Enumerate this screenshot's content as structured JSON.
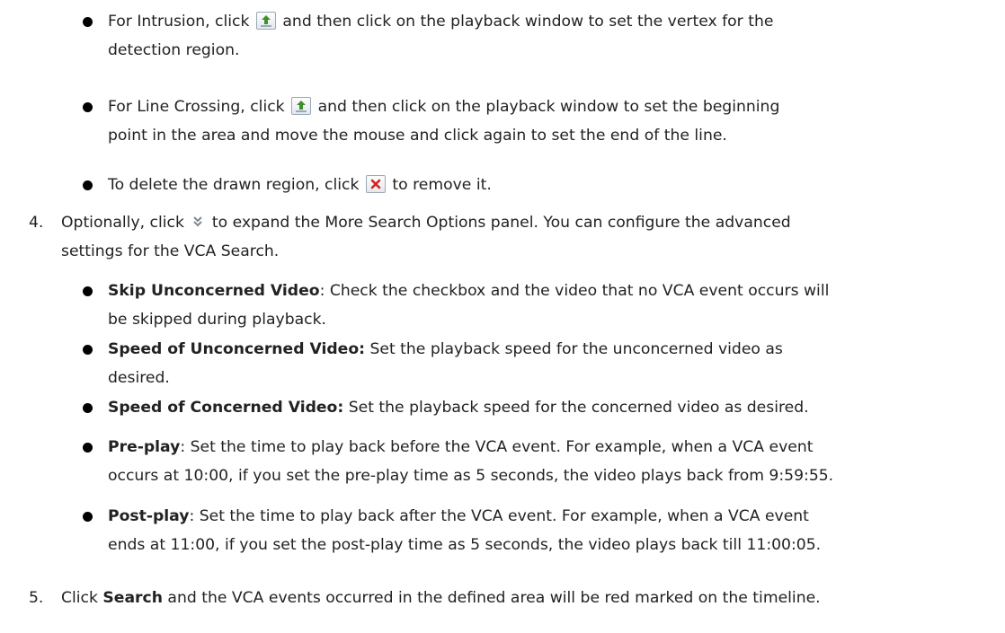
{
  "bullets_region": [
    {
      "text_a": "For Intrusion, click",
      "icon": "add-vertex-icon",
      "text_b": "and then click on the playback window to set the vertex for the",
      "line2": "detection region."
    },
    {
      "text_a": "For Line Crossing, click",
      "icon": "add-vertex-icon",
      "text_b": "and then click on the playback window to set the beginning",
      "line2": "point in the area and move the mouse and click again to set the end of the line."
    },
    {
      "text_a": "To delete the drawn region, click",
      "icon": "delete-icon",
      "text_b": "to remove it."
    }
  ],
  "step4": {
    "num": "4.",
    "text_a": "Optionally, click",
    "icon": "expand-down-icon",
    "text_b": "to expand the More Search Options panel. You can configure the advanced",
    "line2": "settings for the VCA Search."
  },
  "options": [
    {
      "bold": "Skip Unconcerned Video",
      "rest1": ": Check the checkbox and the video that no VCA event occurs will",
      "line2": "be skipped during playback."
    },
    {
      "bold": "Speed of Unconcerned Video:",
      "rest1": " Set the playback speed for the unconcerned video as",
      "line2": "desired."
    },
    {
      "bold": "Speed of Concerned Video:",
      "rest1": " Set the playback speed for the concerned video as desired."
    },
    {
      "bold": "Pre-play",
      "rest1": ": Set the time to play back before the VCA event. For example, when a VCA event",
      "line2": "occurs at 10:00, if you set the pre-play time as 5 seconds, the video plays back from 9:59:55."
    },
    {
      "bold": "Post-play",
      "rest1": ": Set the time to play back after the VCA event. For example, when a VCA event",
      "line2": "ends at 11:00, if you set the post-play time as 5 seconds, the video plays back till 11:00:05."
    }
  ],
  "step5": {
    "num": "5.",
    "text_a": "Click ",
    "bold": "Search",
    "text_b": " and the VCA events occurred in the defined area will be red marked on the timeline."
  },
  "colors": {
    "text": "#222222",
    "bullet": "#000000",
    "add_icon_green": "#3f8f2a",
    "delete_icon_red": "#d2231f"
  }
}
